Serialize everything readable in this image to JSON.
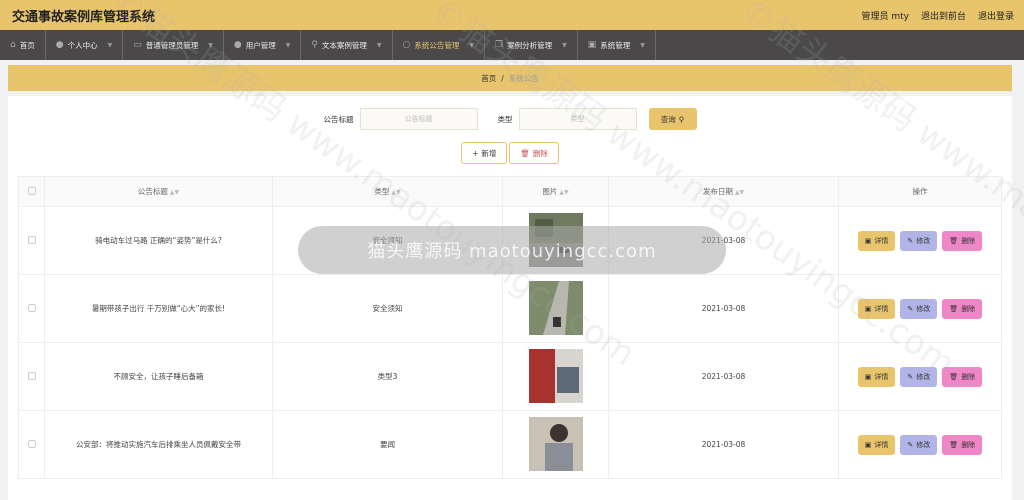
{
  "header": {
    "title": "交通事故案例库管理系统",
    "admin": "管理员 mty",
    "front": "退出到前台",
    "logout": "退出登录"
  },
  "nav": [
    {
      "label": "首页",
      "icon": "home-icon"
    },
    {
      "label": "个人中心",
      "icon": "user-icon"
    },
    {
      "label": "普通管理员管理",
      "icon": "chat-icon"
    },
    {
      "label": "用户管理",
      "icon": "user-icon"
    },
    {
      "label": "文本案例管理",
      "icon": "pin-icon"
    },
    {
      "label": "系统公告管理",
      "icon": "clock-icon"
    },
    {
      "label": "案例分析管理",
      "icon": "copy-icon"
    },
    {
      "label": "系统管理",
      "icon": "monitor-icon"
    }
  ],
  "breadcrumb": {
    "home": "首页",
    "sep": "/",
    "current": "系统公告"
  },
  "search": {
    "title_label": "公告标题",
    "title_placeholder": "公告标题",
    "type_label": "类型",
    "type_placeholder": "类型",
    "query": "查询"
  },
  "actions": {
    "add": "新增",
    "delete": "删除"
  },
  "table": {
    "headers": [
      "公告标题",
      "类型",
      "图片",
      "发布日期",
      "操作"
    ],
    "rows": [
      {
        "title": "骑电动车过马路 正确的“姿势”是什么?",
        "type": "安全须知",
        "date": "2021-03-08"
      },
      {
        "title": "暑期带孩子出行 千万别做“心大”的家长!",
        "type": "安全须知",
        "date": "2021-03-08"
      },
      {
        "title": "不顾安全，让孩子睡后备箱",
        "type": "类型3",
        "date": "2021-03-08"
      },
      {
        "title": "公安部：将推动实施汽车后排乘坐人员佩戴安全带",
        "type": "要闻",
        "date": "2021-03-08"
      }
    ],
    "ops": {
      "detail": "详情",
      "edit": "修改",
      "delete": "删除"
    }
  },
  "overlay": "猫头鹰源码 maotouyingcc.com",
  "watermark": "©猫头鹰源码 www.maotouyingcc.com",
  "colors": {
    "accent": "#e8c46c",
    "nav_bg": "#4a4848",
    "edit": "#b0b4e6",
    "delete": "#ef86c8"
  }
}
